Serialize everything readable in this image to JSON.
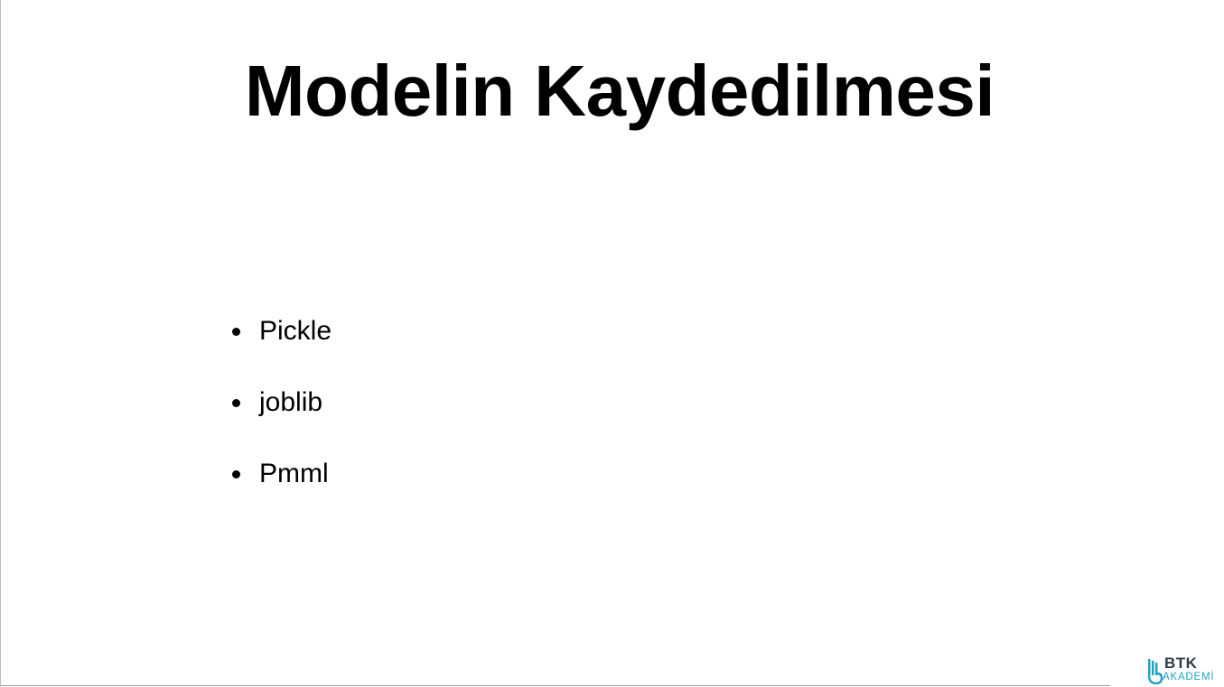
{
  "slide": {
    "title": "Modelin Kaydedilmesi",
    "bullets": [
      {
        "label": "Pickle"
      },
      {
        "label": "joblib"
      },
      {
        "label": "Pmml"
      }
    ]
  },
  "logo": {
    "name": "BTK",
    "subtitle": "AKADEMİ",
    "icon": "btk-akademi-logo-icon",
    "colors": {
      "mark": "#1fa3c4",
      "text": "#2e3a45"
    }
  }
}
